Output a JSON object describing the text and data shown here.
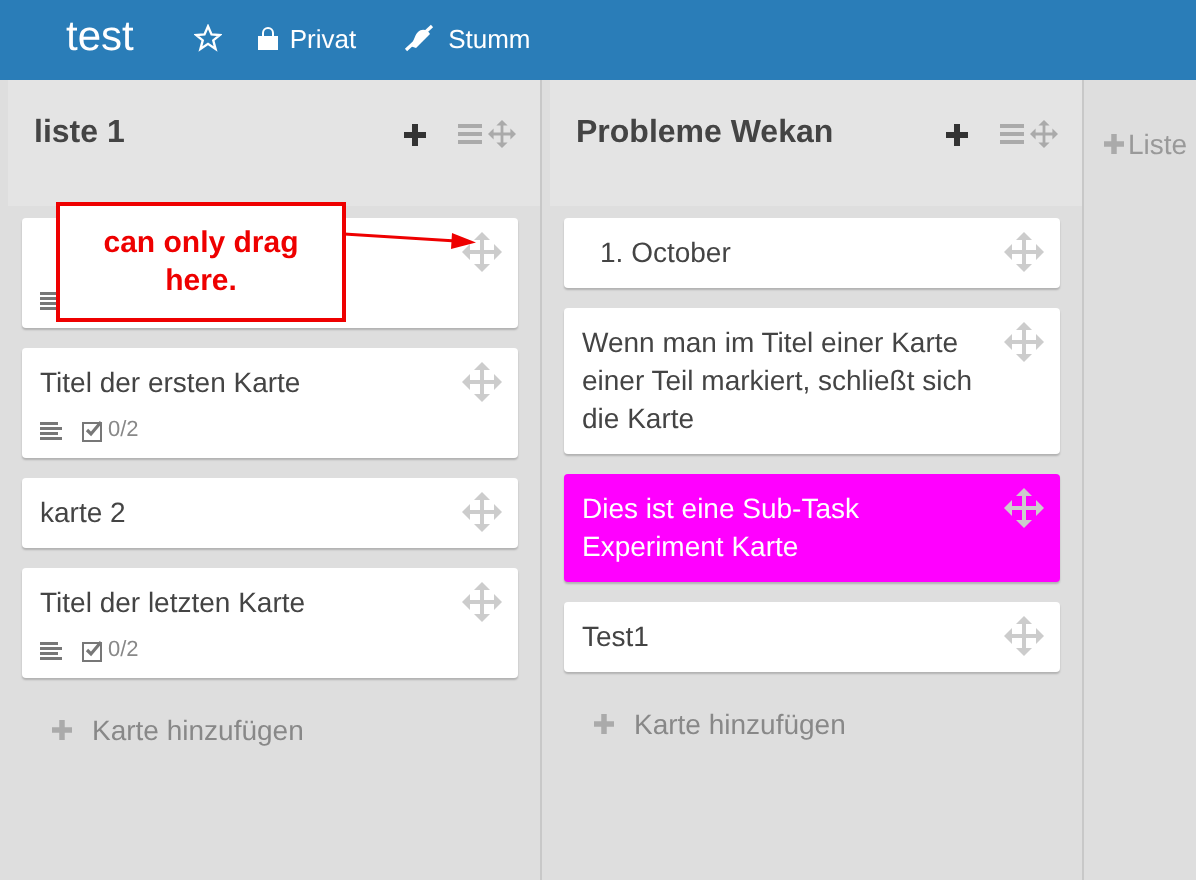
{
  "header": {
    "title": "test",
    "starred": false,
    "items": [
      {
        "kind": "lock",
        "label": "Privat"
      },
      {
        "kind": "mute",
        "label": "Stumm"
      }
    ]
  },
  "lists": [
    {
      "title": "liste 1",
      "add_card": "Karte hinzufügen",
      "cards": [
        {
          "description": true
        },
        {
          "title": "Titel der ersten Karte",
          "description": true,
          "checklist": "0/2"
        },
        {
          "title": "karte 2"
        },
        {
          "title": "Titel der letzten Karte",
          "description": true,
          "checklist": "0/2"
        }
      ]
    },
    {
      "title": "Probleme Wekan",
      "add_card": "Karte hinzufügen",
      "cards": [
        {
          "title": "1. October",
          "indent": true
        },
        {
          "title": "Wenn man im Titel einer Karte einer Teil markiert, schließt sich die Karte"
        },
        {
          "title": "Dies ist eine Sub-Task Experiment Karte",
          "color": "#ff00ff"
        },
        {
          "title": "Test1"
        }
      ]
    }
  ],
  "add_list": "Liste",
  "callout": {
    "text": "can only drag here."
  }
}
